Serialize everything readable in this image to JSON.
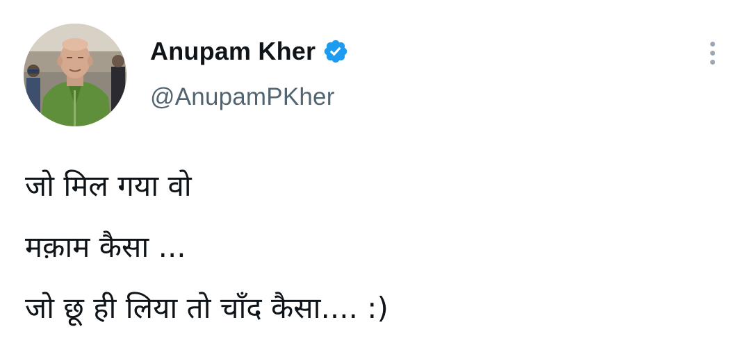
{
  "author": {
    "display_name": "Anupam Kher",
    "handle": "@AnupamPKher",
    "verified": true,
    "verified_icon": "verified-badge-icon",
    "verified_color": "#1d9bf0"
  },
  "menu": {
    "icon": "more-vertical-icon"
  },
  "tweet": {
    "lines": [
      "जो मिल गया वो",
      "मक़ाम कैसा ...",
      "जो छू ही लिया तो चाँद कैसा.... :)"
    ]
  },
  "colors": {
    "text_primary": "#0f1419",
    "text_secondary": "#536471",
    "dots": "#9ca7b1"
  }
}
